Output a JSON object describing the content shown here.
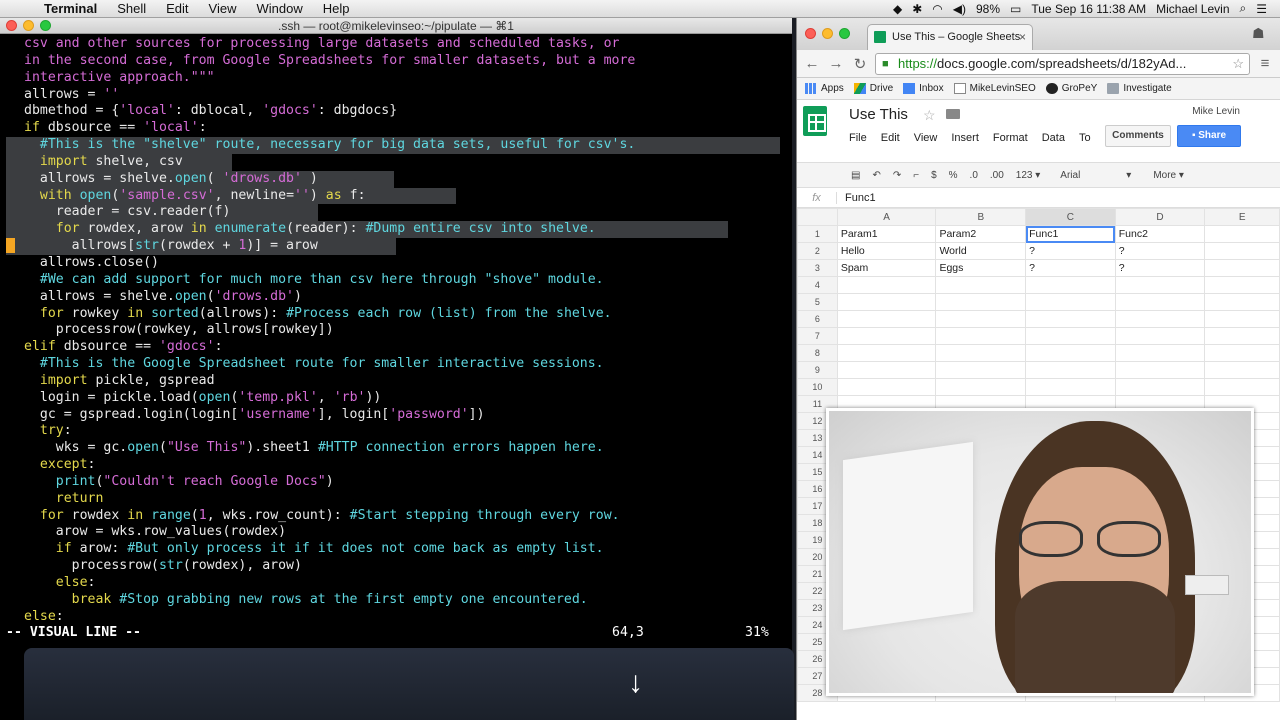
{
  "menubar": {
    "app": "Terminal",
    "items": [
      "Shell",
      "Edit",
      "View",
      "Window",
      "Help"
    ],
    "battery": "98%",
    "clock": "Tue Sep 16  11:38 AM",
    "user": "Michael Levin"
  },
  "terminal": {
    "title": ".ssh — root@mikelevinseo:~/pipulate — ⌘1",
    "mode": "-- VISUAL LINE --",
    "position": "64,3",
    "percent": "31%"
  },
  "chrome": {
    "tab_title": "Use This – Google Sheets",
    "tab_close": "×",
    "url_scheme": "https://",
    "url_rest": "docs.google.com/spreadsheets/d/182yAd...",
    "bookmarks": [
      "Apps",
      "Drive",
      "Inbox",
      "MikeLevinSEO",
      "GroPeY",
      "Investigate"
    ]
  },
  "sheet": {
    "title": "Use This",
    "user": "Mike Levin",
    "menus": [
      "File",
      "Edit",
      "View",
      "Insert",
      "Format",
      "Data",
      "To"
    ],
    "comments_label": "Comments",
    "share_label": "Share",
    "toolbar": [
      "$",
      "%",
      ".0",
      ".00",
      "123 ▾",
      "Arial",
      "▾",
      "More ▾"
    ],
    "formula_value": "Func1",
    "columns": [
      "A",
      "B",
      "C",
      "D",
      "E"
    ],
    "rows": [
      [
        "Param1",
        "Param2",
        "Func1",
        "Func2",
        ""
      ],
      [
        "Hello",
        "World",
        "?",
        "?",
        ""
      ],
      [
        "Spam",
        "Eggs",
        "?",
        "?",
        ""
      ]
    ],
    "row_numbers": [
      "1",
      "2",
      "3",
      "4",
      "5",
      "6",
      "7",
      "8",
      "9",
      "10",
      "11",
      "12",
      "13",
      "14",
      "15",
      "16",
      "17",
      "18",
      "19",
      "20",
      "21",
      "22",
      "23",
      "24",
      "25",
      "26",
      "27",
      "28"
    ]
  }
}
